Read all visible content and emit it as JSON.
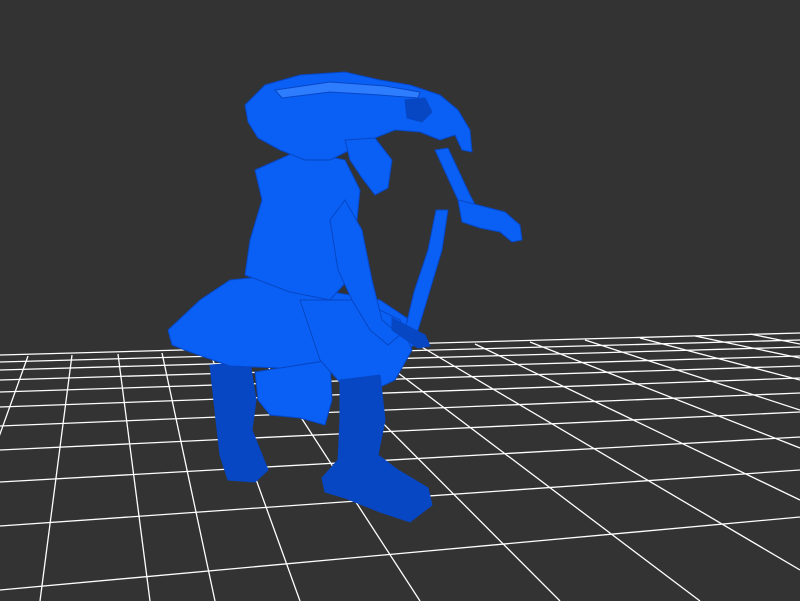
{
  "scene": {
    "background_color": "#333333",
    "grid_color": "#ffffff",
    "model_color": "#0a5ff5",
    "model_shade_color": "#0747c4",
    "model_highlight_color": "#2f7dff",
    "model_icon": "armored-swordsman-figure-icon"
  }
}
